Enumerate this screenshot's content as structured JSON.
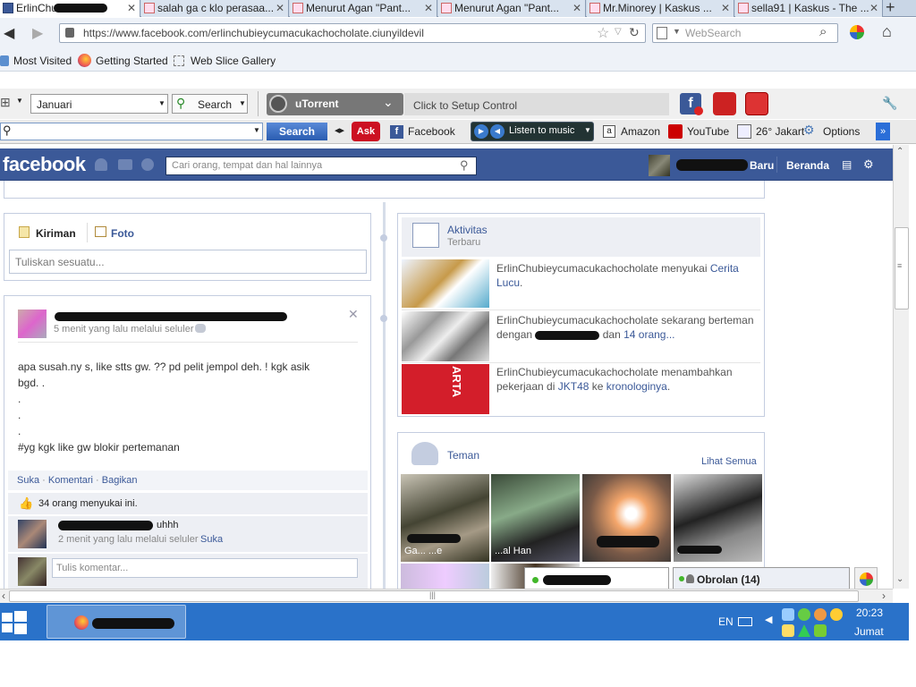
{
  "tabs": [
    {
      "label": "ErlinChu... ..u..."
    },
    {
      "label": "salah ga c klo perasaa..."
    },
    {
      "label": "Menurut Agan \"Pant..."
    },
    {
      "label": "Menurut Agan \"Pant..."
    },
    {
      "label": "Mr.Minorey | Kaskus ..."
    },
    {
      "label": "sella91 | Kaskus - The ..."
    }
  ],
  "nav": {
    "url": "https://www.facebook.com/erlinchubieycumacukachocholate.ciunyildevil",
    "search_placeholder": "WebSearch"
  },
  "bookmarks": [
    "Most Visited",
    "Getting Started",
    "Web Slice Gallery"
  ],
  "toolbar1": {
    "month": "Januari",
    "search_label": "Search",
    "utorrent_label": "uTorrent",
    "setup_control": "Click to Setup Control"
  },
  "toolbar2": {
    "search_button": "Search",
    "facebook": "Facebook",
    "listen": "Listen to music",
    "amazon": "Amazon",
    "youtube": "YouTube",
    "weather": "26° Jakart",
    "options": "Options"
  },
  "fb": {
    "logo": "facebook",
    "search_placeholder": "Cari orang, tempat dan hal lainnya",
    "home": "Beranda",
    "find_friends": "Baru"
  },
  "composer": {
    "tab_status": "Kiriman",
    "tab_photo": "Foto",
    "placeholder": "Tuliskan sesuatu..."
  },
  "post": {
    "time": "5 menit yang lalu melalui seluler",
    "body": [
      "apa susah.ny s, like stts gw. ?? pd pelit jempol deh. ! kgk asik",
      "bgd. .",
      ".",
      ".",
      ".",
      "#yg kgk like gw blokir pertemanan"
    ],
    "actions": {
      "like": "Suka",
      "comment": "Komentari",
      "share": "Bagikan"
    },
    "likes": "34 orang menyukai ini.",
    "comment_suffix": "uhhh",
    "comment_time": "2 menit yang lalu melalui seluler",
    "comment_like": "Suka",
    "comment_placeholder": "Tulis komentar..."
  },
  "activity": {
    "title": "Aktivitas",
    "subtitle": "Terbaru",
    "items": [
      {
        "actor": "ErlinChubieycumacukachocholate",
        "verb": "menyukai",
        "link": "Cerita Lucu",
        "end": "."
      },
      {
        "actor": "ErlinChubieycumacukachocholate",
        "verb": "sekarang berteman dengan",
        "mid": "dan",
        "link": "14 orang...",
        "end": ""
      },
      {
        "actor": "ErlinChubieycumacukachocholate",
        "verb": "menambahkan pekerjaan di",
        "link": "JKT48",
        "mid": "ke",
        "link2": "kronologinya",
        "end": "."
      }
    ]
  },
  "friends": {
    "title": "Teman",
    "see_all": "Lihat Semua",
    "names": [
      "Ga... ...e",
      "...al Han",
      "",
      "...Ga..."
    ]
  },
  "chat": {
    "label": "Obrolan (14)"
  },
  "taskbar": {
    "lang": "EN",
    "time": "20:23",
    "day": "Jumat"
  },
  "colors": {
    "fb_blue": "#3b5998",
    "taskbar": "#2a72c9"
  }
}
